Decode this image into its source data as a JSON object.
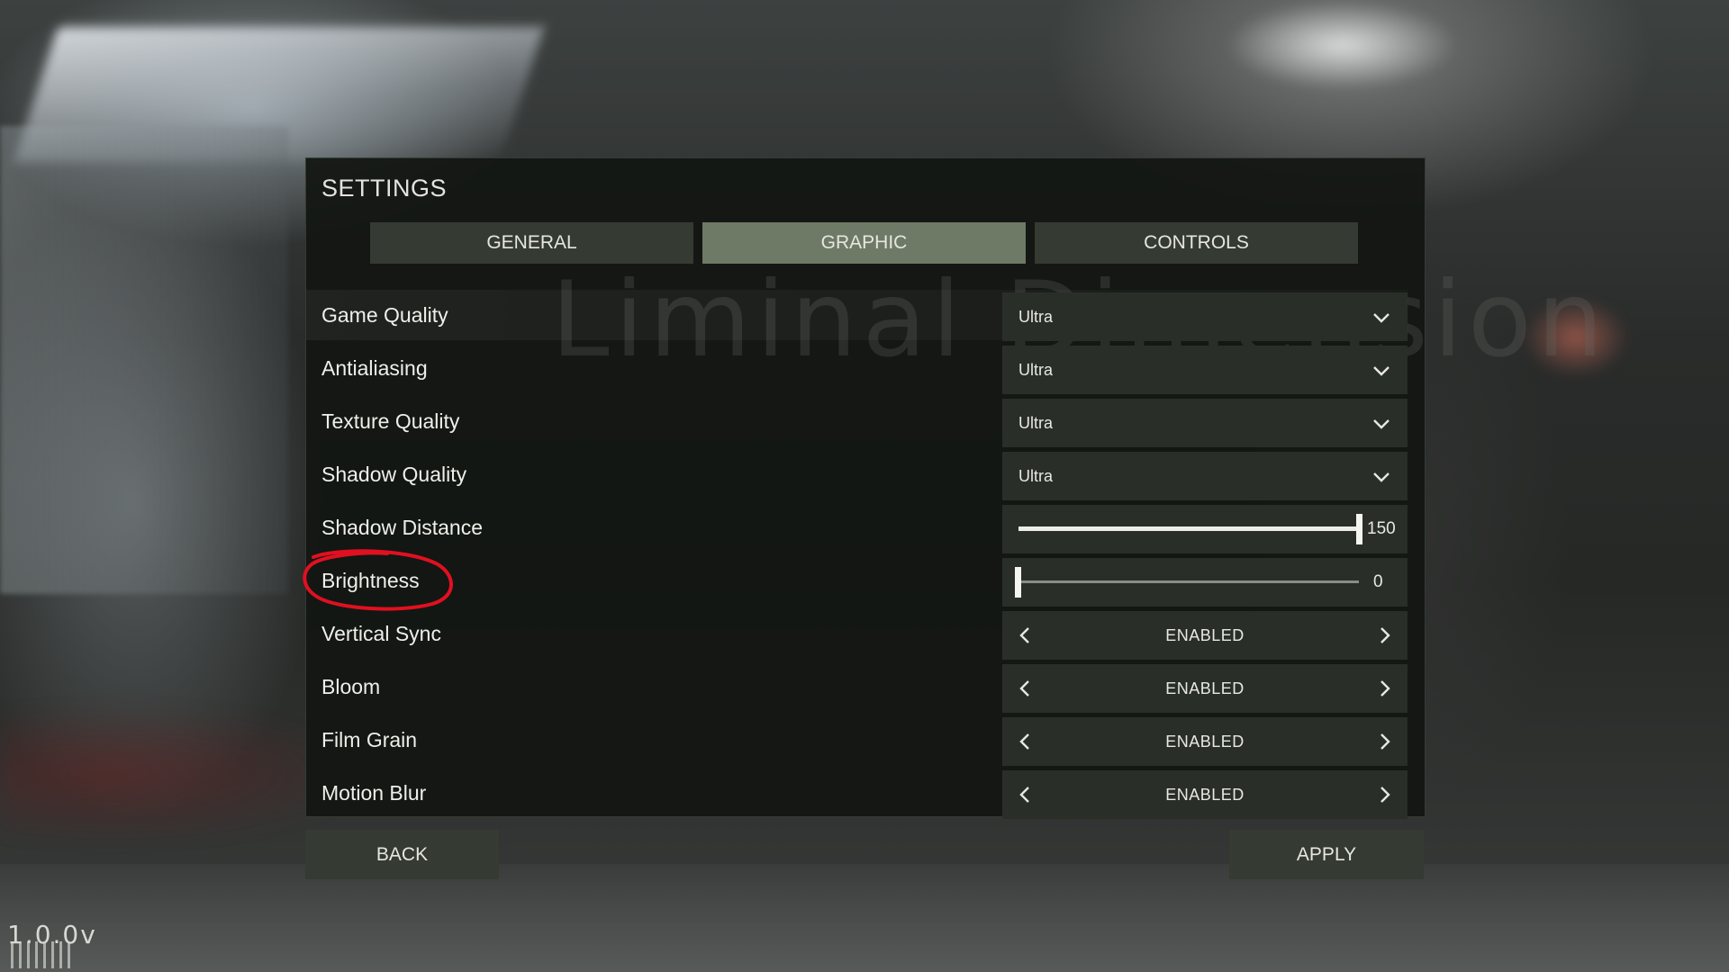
{
  "settings": {
    "title": "SETTINGS",
    "watermark": "Liminal Dimension",
    "tabs": [
      {
        "label": "GENERAL",
        "active": false
      },
      {
        "label": "GRAPHIC",
        "active": true
      },
      {
        "label": "CONTROLS",
        "active": false
      }
    ],
    "dropdowns": [
      {
        "label": "Game Quality",
        "value": "Ultra"
      },
      {
        "label": "Antialiasing",
        "value": "Ultra"
      },
      {
        "label": "Texture Quality",
        "value": "Ultra"
      },
      {
        "label": "Shadow Quality",
        "value": "Ultra"
      }
    ],
    "sliders": [
      {
        "label": "Shadow Distance",
        "value": "150",
        "fill_fraction": 1.0
      },
      {
        "label": "Brightness",
        "value": "0",
        "fill_fraction": 0.0
      }
    ],
    "toggles": [
      {
        "label": "Vertical Sync",
        "value": "ENABLED"
      },
      {
        "label": "Bloom",
        "value": "ENABLED"
      },
      {
        "label": "Film Grain",
        "value": "ENABLED"
      },
      {
        "label": "Motion Blur",
        "value": "ENABLED"
      }
    ],
    "buttons": {
      "back": "BACK",
      "apply": "APPLY"
    }
  },
  "annotation": {
    "target": "Brightness",
    "color": "#e01020"
  },
  "version": "1.0.0v",
  "colors": {
    "tab_active": "#6e7a65",
    "tab_inactive": "#353a33",
    "control_bg": "#2a2e29"
  },
  "icons": {
    "dropdown": "chevron-down-icon",
    "prev": "chevron-left-icon",
    "next": "chevron-right-icon"
  }
}
